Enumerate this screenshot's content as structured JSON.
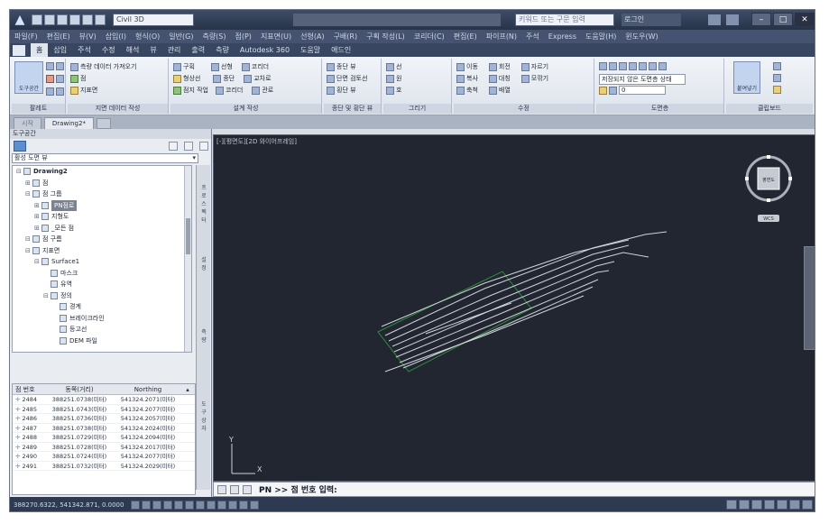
{
  "titlebar": {
    "workspace": "Civil 3D",
    "title": "",
    "help_search": "키워드 또는 구문 입력",
    "signin": "로그인"
  },
  "menubar": {
    "items": [
      "파일(F)",
      "편집(E)",
      "뷰(V)",
      "삽입(I)",
      "형식(O)",
      "일반(G)",
      "측량(S)",
      "점(P)",
      "지표면(U)",
      "선형(A)",
      "구배(R)",
      "구획 작성(L)",
      "코리더(C)",
      "편집(E)",
      "파이프(N)",
      "주석",
      "Express",
      "도움말(H)",
      "윈도우(W)"
    ]
  },
  "ribbon": {
    "tabs": [
      "홈",
      "삽입",
      "주석",
      "수정",
      "해석",
      "뷰",
      "관리",
      "출력",
      "측량",
      "Autodesk 360",
      "도움말",
      "애드인"
    ],
    "active_tab": "홈",
    "panels": [
      {
        "title": "팔레트",
        "big": "도구공간"
      },
      {
        "title": "지면 데이터 작성",
        "rows": [
          "측량 데이터 가져오기",
          "점",
          "지표면"
        ]
      },
      {
        "title": "설계 작성",
        "rows": [
          "구획",
          "선형",
          "코리더",
          "형상선",
          "종단",
          "교차로",
          "점지 작업",
          "코리더",
          "관로"
        ]
      },
      {
        "title": "종단 및 횡단 뷰",
        "rows": [
          "종단 뷰",
          "단면 검토선",
          "횡단 뷰"
        ]
      },
      {
        "title": "그리기",
        "rows": [
          "선",
          "원",
          "호"
        ]
      },
      {
        "title": "수정",
        "rows": [
          "이동",
          "회전",
          "자르기",
          "복사",
          "대칭",
          "모깎기",
          "축척",
          "배열"
        ]
      },
      {
        "title": "도면층",
        "rows": [
          "저장되지 않은 도면층 상태",
          "0"
        ]
      },
      {
        "title": "클립보드",
        "big": "붙여넣기"
      }
    ]
  },
  "doctabs": [
    "시작",
    "Drawing2*"
  ],
  "palette": {
    "title": "도구공간",
    "combo": "활성 도면 뷰",
    "tree": [
      {
        "label": "Drawing2",
        "level": 0,
        "toggle": "⊟",
        "bold": true
      },
      {
        "label": "점",
        "level": 1,
        "toggle": "⊞"
      },
      {
        "label": "점 그룹",
        "level": 1,
        "toggle": "⊟"
      },
      {
        "label": "PN점로",
        "level": 2,
        "toggle": "⊞",
        "selected": true
      },
      {
        "label": "지형도",
        "level": 2,
        "toggle": "⊞"
      },
      {
        "label": "_모든 점",
        "level": 2,
        "toggle": "⊞"
      },
      {
        "label": "점 구름",
        "level": 1,
        "toggle": "⊟"
      },
      {
        "label": "지표면",
        "level": 1,
        "toggle": "⊟"
      },
      {
        "label": "Surface1",
        "level": 2,
        "toggle": "⊟"
      },
      {
        "label": "마스크",
        "level": 3,
        "toggle": ""
      },
      {
        "label": "유역",
        "level": 3,
        "toggle": ""
      },
      {
        "label": "정의",
        "level": 3,
        "toggle": "⊟"
      },
      {
        "label": "경계",
        "level": 4,
        "toggle": ""
      },
      {
        "label": "브레이크라인",
        "level": 4,
        "toggle": ""
      },
      {
        "label": "등고선",
        "level": 4,
        "toggle": ""
      },
      {
        "label": "DEM 파일",
        "level": 4,
        "toggle": ""
      }
    ],
    "side_tabs": [
      "프로스펙터",
      "설정",
      "측량",
      "도구상자"
    ]
  },
  "point_table": {
    "headers": [
      "점 번호",
      "동쪽(거리)",
      "Northing"
    ],
    "rows": [
      [
        "2484",
        "388251.0738(미터)",
        "541324.2071(미터)"
      ],
      [
        "2485",
        "388251.0743(미터)",
        "541324.2077(미터)"
      ],
      [
        "2486",
        "388251.0736(미터)",
        "541324.2057(미터)"
      ],
      [
        "2487",
        "388251.0738(미터)",
        "541324.2024(미터)"
      ],
      [
        "2488",
        "388251.0729(미터)",
        "541324.2094(미터)"
      ],
      [
        "2489",
        "388251.0728(미터)",
        "541324.2017(미터)"
      ],
      [
        "2490",
        "388251.0724(미터)",
        "541324.2077(미터)"
      ],
      [
        "2491",
        "388251.0732(미터)",
        "541324.2029(미터)"
      ]
    ]
  },
  "viewport": {
    "label": "[-][평면도][2D 와이어프레임]",
    "viewcube_face": "평면도",
    "wcs": "WCS",
    "axis_y": "Y",
    "axis_x": "X",
    "colors": {
      "bg": "#212630",
      "lines": "#cfd3da",
      "boundary": "#2f8a3e"
    }
  },
  "cmdline": {
    "prompt": "PN >> 점 번호 입력:"
  },
  "statusbar": {
    "coords": "388270.6322, 541342.871, 0.0000"
  }
}
